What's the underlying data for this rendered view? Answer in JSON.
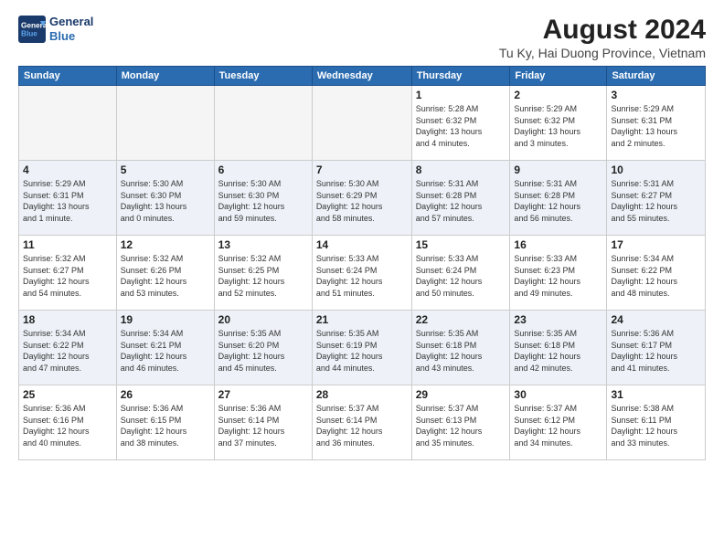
{
  "header": {
    "logo_line1": "General",
    "logo_line2": "Blue",
    "title": "August 2024",
    "subtitle": "Tu Ky, Hai Duong Province, Vietnam"
  },
  "weekdays": [
    "Sunday",
    "Monday",
    "Tuesday",
    "Wednesday",
    "Thursday",
    "Friday",
    "Saturday"
  ],
  "weeks": [
    [
      {
        "day": "",
        "info": ""
      },
      {
        "day": "",
        "info": ""
      },
      {
        "day": "",
        "info": ""
      },
      {
        "day": "",
        "info": ""
      },
      {
        "day": "1",
        "info": "Sunrise: 5:28 AM\nSunset: 6:32 PM\nDaylight: 13 hours\nand 4 minutes."
      },
      {
        "day": "2",
        "info": "Sunrise: 5:29 AM\nSunset: 6:32 PM\nDaylight: 13 hours\nand 3 minutes."
      },
      {
        "day": "3",
        "info": "Sunrise: 5:29 AM\nSunset: 6:31 PM\nDaylight: 13 hours\nand 2 minutes."
      }
    ],
    [
      {
        "day": "4",
        "info": "Sunrise: 5:29 AM\nSunset: 6:31 PM\nDaylight: 13 hours\nand 1 minute."
      },
      {
        "day": "5",
        "info": "Sunrise: 5:30 AM\nSunset: 6:30 PM\nDaylight: 13 hours\nand 0 minutes."
      },
      {
        "day": "6",
        "info": "Sunrise: 5:30 AM\nSunset: 6:30 PM\nDaylight: 12 hours\nand 59 minutes."
      },
      {
        "day": "7",
        "info": "Sunrise: 5:30 AM\nSunset: 6:29 PM\nDaylight: 12 hours\nand 58 minutes."
      },
      {
        "day": "8",
        "info": "Sunrise: 5:31 AM\nSunset: 6:28 PM\nDaylight: 12 hours\nand 57 minutes."
      },
      {
        "day": "9",
        "info": "Sunrise: 5:31 AM\nSunset: 6:28 PM\nDaylight: 12 hours\nand 56 minutes."
      },
      {
        "day": "10",
        "info": "Sunrise: 5:31 AM\nSunset: 6:27 PM\nDaylight: 12 hours\nand 55 minutes."
      }
    ],
    [
      {
        "day": "11",
        "info": "Sunrise: 5:32 AM\nSunset: 6:27 PM\nDaylight: 12 hours\nand 54 minutes."
      },
      {
        "day": "12",
        "info": "Sunrise: 5:32 AM\nSunset: 6:26 PM\nDaylight: 12 hours\nand 53 minutes."
      },
      {
        "day": "13",
        "info": "Sunrise: 5:32 AM\nSunset: 6:25 PM\nDaylight: 12 hours\nand 52 minutes."
      },
      {
        "day": "14",
        "info": "Sunrise: 5:33 AM\nSunset: 6:24 PM\nDaylight: 12 hours\nand 51 minutes."
      },
      {
        "day": "15",
        "info": "Sunrise: 5:33 AM\nSunset: 6:24 PM\nDaylight: 12 hours\nand 50 minutes."
      },
      {
        "day": "16",
        "info": "Sunrise: 5:33 AM\nSunset: 6:23 PM\nDaylight: 12 hours\nand 49 minutes."
      },
      {
        "day": "17",
        "info": "Sunrise: 5:34 AM\nSunset: 6:22 PM\nDaylight: 12 hours\nand 48 minutes."
      }
    ],
    [
      {
        "day": "18",
        "info": "Sunrise: 5:34 AM\nSunset: 6:22 PM\nDaylight: 12 hours\nand 47 minutes."
      },
      {
        "day": "19",
        "info": "Sunrise: 5:34 AM\nSunset: 6:21 PM\nDaylight: 12 hours\nand 46 minutes."
      },
      {
        "day": "20",
        "info": "Sunrise: 5:35 AM\nSunset: 6:20 PM\nDaylight: 12 hours\nand 45 minutes."
      },
      {
        "day": "21",
        "info": "Sunrise: 5:35 AM\nSunset: 6:19 PM\nDaylight: 12 hours\nand 44 minutes."
      },
      {
        "day": "22",
        "info": "Sunrise: 5:35 AM\nSunset: 6:18 PM\nDaylight: 12 hours\nand 43 minutes."
      },
      {
        "day": "23",
        "info": "Sunrise: 5:35 AM\nSunset: 6:18 PM\nDaylight: 12 hours\nand 42 minutes."
      },
      {
        "day": "24",
        "info": "Sunrise: 5:36 AM\nSunset: 6:17 PM\nDaylight: 12 hours\nand 41 minutes."
      }
    ],
    [
      {
        "day": "25",
        "info": "Sunrise: 5:36 AM\nSunset: 6:16 PM\nDaylight: 12 hours\nand 40 minutes."
      },
      {
        "day": "26",
        "info": "Sunrise: 5:36 AM\nSunset: 6:15 PM\nDaylight: 12 hours\nand 38 minutes."
      },
      {
        "day": "27",
        "info": "Sunrise: 5:36 AM\nSunset: 6:14 PM\nDaylight: 12 hours\nand 37 minutes."
      },
      {
        "day": "28",
        "info": "Sunrise: 5:37 AM\nSunset: 6:14 PM\nDaylight: 12 hours\nand 36 minutes."
      },
      {
        "day": "29",
        "info": "Sunrise: 5:37 AM\nSunset: 6:13 PM\nDaylight: 12 hours\nand 35 minutes."
      },
      {
        "day": "30",
        "info": "Sunrise: 5:37 AM\nSunset: 6:12 PM\nDaylight: 12 hours\nand 34 minutes."
      },
      {
        "day": "31",
        "info": "Sunrise: 5:38 AM\nSunset: 6:11 PM\nDaylight: 12 hours\nand 33 minutes."
      }
    ]
  ]
}
